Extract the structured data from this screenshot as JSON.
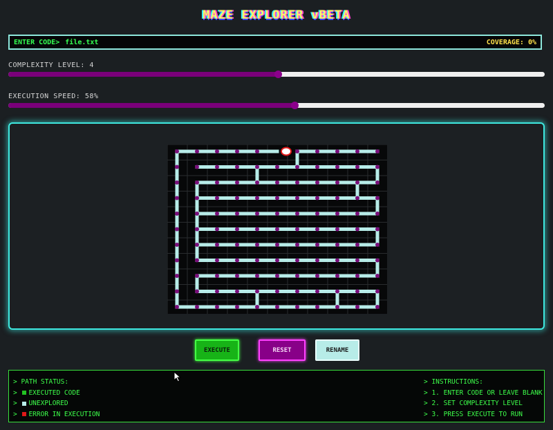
{
  "title": "MAZE EXPLORER vBETA",
  "code_bar": {
    "prompt": "ENTER CODE>",
    "value": "file.txt",
    "coverage_label": "COVERAGE: 0%"
  },
  "complexity": {
    "label": "COMPLEXITY LEVEL: 4",
    "level": 4,
    "fraction": 0.503
  },
  "speed": {
    "label": "EXECUTION SPEED: 58%",
    "percent": 58,
    "fraction": 0.533
  },
  "buttons": {
    "execute": "EXECUTE",
    "reset": "RESET",
    "rename": "RENAME"
  },
  "status": {
    "heading": "> PATH STATUS:",
    "items": [
      {
        "prefix": "> ",
        "label": "EXECUTED CODE",
        "color": "#22c322"
      },
      {
        "prefix": "> ",
        "label": "UNEXPLORED",
        "color": "#b7ece8"
      },
      {
        "prefix": "> ",
        "label": "ERROR IN EXECUTION",
        "color": "#e01818"
      }
    ]
  },
  "instructions": {
    "heading": "> INSTRUCTIONS:",
    "items": [
      "> 1. ENTER CODE OR LEAVE BLANK",
      "> 2. SET COMPLEXITY LEVEL",
      "> 3. PRESS EXECUTE TO RUN"
    ]
  },
  "colors": {
    "path": "#b7ece8",
    "node": "#7a0f7a",
    "maze_bg": "#070809",
    "grid": "#2a2d2f",
    "player_fill": "#ffffff",
    "player_stroke": "#e01818"
  },
  "maze": {
    "grid_size": [
      11,
      8.5
    ],
    "player": [
      5,
      0
    ]
  }
}
